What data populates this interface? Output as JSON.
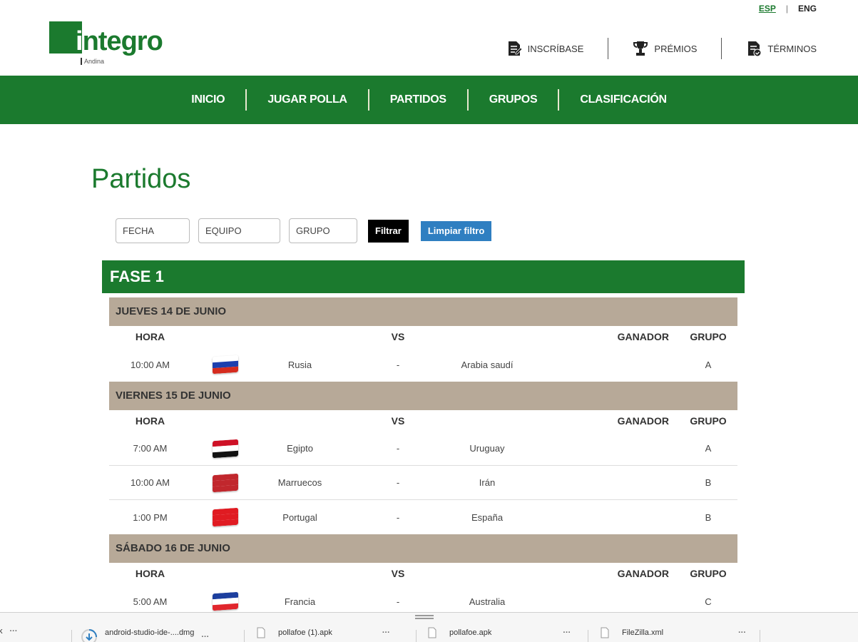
{
  "lang": {
    "active": "ESP",
    "other": "ENG"
  },
  "logo": {
    "word_start": "i",
    "word_rest": "ntegro",
    "sub": "Andina"
  },
  "util_nav": [
    {
      "label": "INSCRÍBASE",
      "icon": "register-document-icon"
    },
    {
      "label": "PRÉMIOS",
      "icon": "trophy-icon"
    },
    {
      "label": "TÉRMINOS",
      "icon": "terms-document-icon"
    }
  ],
  "nav": [
    "INICIO",
    "JUGAR POLLA",
    "PARTIDOS",
    "GRUPOS",
    "CLASIFICACIÓN"
  ],
  "page_title": "Partidos",
  "filters": {
    "fecha_placeholder": "FECHA",
    "equipo_placeholder": "EQUIPO",
    "grupo_placeholder": "GRUPO",
    "filter_label": "Filtrar",
    "clear_label": "Limpiar filtro"
  },
  "phase": "FASE 1",
  "headers": {
    "hora": "HORA",
    "vs": "VS",
    "ganador": "GANADOR",
    "grupo": "GRUPO"
  },
  "days": [
    {
      "label": "JUEVES 14 DE JUNIO",
      "matches": [
        {
          "time": "10:00 AM",
          "home": "Rusia",
          "home_flag": [
            "#ffffff",
            "#1c3fae",
            "#d52b1e"
          ],
          "sep": "-",
          "away": "Arabia saudí",
          "away_flag": [
            "#0a7a3a",
            "#0a7a3a",
            "#0a7a3a"
          ],
          "winner": "",
          "group": "A"
        }
      ]
    },
    {
      "label": "VIERNES 15 DE JUNIO",
      "matches": [
        {
          "time": "7:00 AM",
          "home": "Egipto",
          "home_flag": [
            "#ce1126",
            "#ffffff",
            "#111111"
          ],
          "sep": "-",
          "away": "Uruguay",
          "away_flag": [
            "#ffffff",
            "#5b8fd6",
            "#ffffff"
          ],
          "winner": "",
          "group": "A"
        },
        {
          "time": "10:00 AM",
          "home": "Marruecos",
          "home_flag": [
            "#c1272d",
            "#c1272d",
            "#c1272d"
          ],
          "sep": "-",
          "away": "Irán",
          "away_flag": [
            "#239f40",
            "#ffffff",
            "#da0000"
          ],
          "winner": "",
          "group": "B"
        },
        {
          "time": "1:00 PM",
          "home": "Portugal",
          "home_flag": [
            "#e01b22",
            "#e01b22",
            "#e01b22"
          ],
          "sep": "-",
          "away": "España",
          "away_flag": [
            "#c60b1e",
            "#ffc400",
            "#c60b1e"
          ],
          "winner": "",
          "group": "B"
        }
      ]
    },
    {
      "label": "SÁBADO 16 DE JUNIO",
      "matches": [
        {
          "time": "5:00 AM",
          "home": "Francia",
          "home_flag": [
            "#1d3f9e",
            "#ffffff",
            "#e1262d"
          ],
          "sep": "-",
          "away": "Australia",
          "away_flag": [
            "#1f2a7a",
            "#1f2a7a",
            "#1f2a7a"
          ],
          "winner": "",
          "group": "C"
        }
      ]
    }
  ],
  "downloads": [
    {
      "name": "k",
      "icon": "file-icon"
    },
    {
      "name": "android-studio-ide-....dmg",
      "icon": "download-progress-icon"
    },
    {
      "name": "pollafoe (1).apk",
      "icon": "file-icon"
    },
    {
      "name": "pollafoe.apk",
      "icon": "file-icon"
    },
    {
      "name": "FileZilla.xml",
      "icon": "file-icon"
    }
  ]
}
